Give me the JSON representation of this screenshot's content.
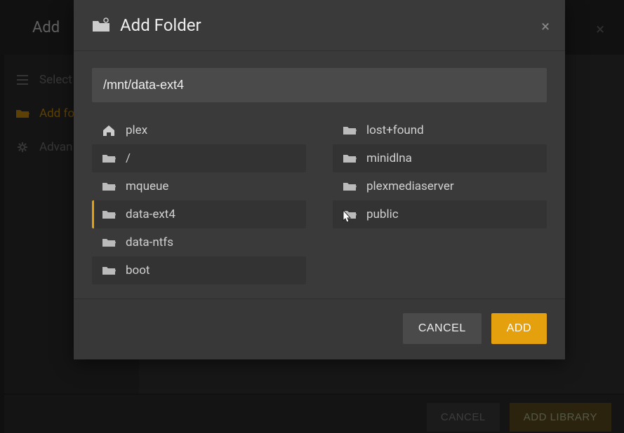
{
  "background": {
    "header_title": "Add",
    "sidebar": {
      "select": "Select",
      "addfolder": "Add fo",
      "advanced": "Advan"
    },
    "footer": {
      "cancel": "CANCEL",
      "addlibrary": "ADD LIBRARY"
    }
  },
  "modal": {
    "title": "Add Folder",
    "path": "/mnt/data-ext4",
    "left": {
      "home": "plex",
      "root": "/",
      "mqueue": "mqueue",
      "dataext4": "data-ext4",
      "datantfs": "data-ntfs",
      "boot": "boot"
    },
    "right": {
      "lostfound": "lost+found",
      "minidlna": "minidlna",
      "plexmedia": "plexmediaserver",
      "public": "public"
    },
    "cancel": "CANCEL",
    "add": "ADD"
  }
}
